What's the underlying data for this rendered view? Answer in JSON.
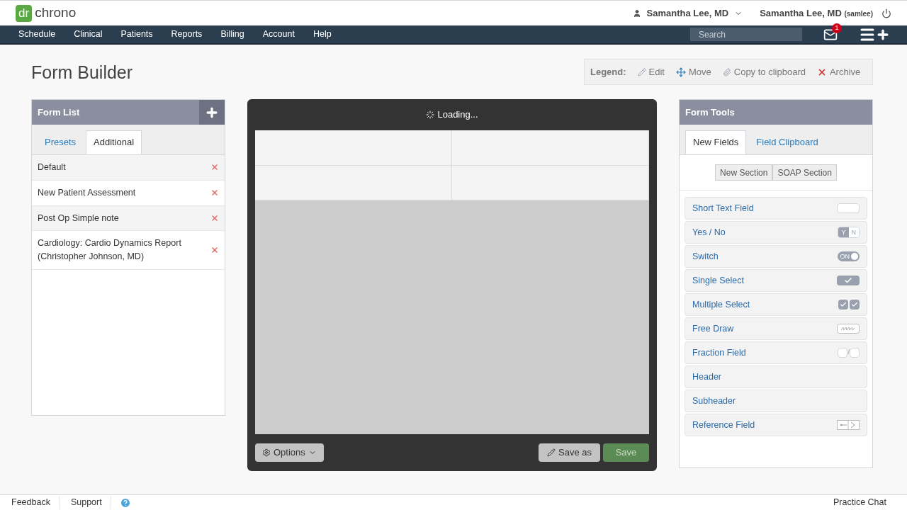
{
  "header": {
    "logo": {
      "mark": "dr",
      "word": "chrono"
    },
    "provider": "Samantha Lee, MD",
    "user": "Samantha Lee, MD",
    "username": "(samlee)"
  },
  "nav": {
    "items": [
      "Schedule",
      "Clinical",
      "Patients",
      "Reports",
      "Billing",
      "Account",
      "Help"
    ],
    "search": {
      "placeholder": "Search"
    },
    "mail_badge": "1"
  },
  "page": {
    "title": "Form Builder"
  },
  "legend": {
    "label": "Legend:",
    "items": [
      {
        "kind": "edit",
        "label": "Edit"
      },
      {
        "kind": "move",
        "label": "Move"
      },
      {
        "kind": "copy",
        "label": "Copy to clipboard"
      },
      {
        "kind": "archive",
        "label": "Archive"
      }
    ]
  },
  "form_list": {
    "title": "Form List",
    "tabs": [
      {
        "label": "Presets",
        "selected": false
      },
      {
        "label": "Additional",
        "selected": true
      }
    ],
    "items": [
      {
        "label": "Default"
      },
      {
        "label": "New Patient Assessment"
      },
      {
        "label": "Post Op Simple note"
      },
      {
        "label": "Cardiology: Cardio Dynamics Report (Christopher Johnson, MD)"
      }
    ]
  },
  "editor": {
    "status": "Loading...",
    "options": "Options",
    "save_as": "Save as",
    "save": "Save"
  },
  "form_tools": {
    "title": "Form Tools",
    "tabs": [
      {
        "label": "New Fields",
        "selected": true
      },
      {
        "label": "Field Clipboard",
        "selected": false
      }
    ],
    "section_buttons": [
      "New Section",
      "SOAP Section"
    ],
    "fields": [
      {
        "label": "Short Text Field",
        "kind": "text"
      },
      {
        "label": "Yes / No",
        "kind": "yesno",
        "preview": [
          "Y",
          "N"
        ]
      },
      {
        "label": "Switch",
        "kind": "switch",
        "preview": [
          "ON"
        ]
      },
      {
        "label": "Single Select",
        "kind": "single"
      },
      {
        "label": "Multiple Select",
        "kind": "multi"
      },
      {
        "label": "Free Draw",
        "kind": "draw"
      },
      {
        "label": "Fraction Field",
        "kind": "fraction",
        "preview": [
          "/"
        ]
      },
      {
        "label": "Header",
        "kind": "plain"
      },
      {
        "label": "Subheader",
        "kind": "plain"
      },
      {
        "label": "Reference Field",
        "kind": "reference"
      }
    ]
  },
  "footer": {
    "links": [
      "Feedback",
      "Support"
    ],
    "chat": "Practice Chat"
  }
}
